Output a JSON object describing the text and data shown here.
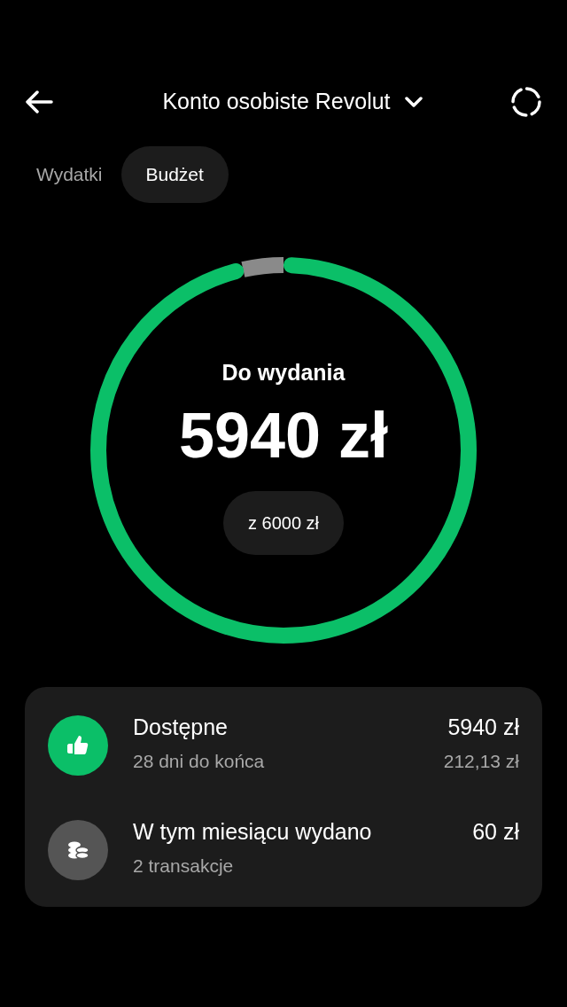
{
  "header": {
    "title": "Konto osobiste Revolut"
  },
  "tabs": [
    {
      "label": "Wydatki",
      "selected": false
    },
    {
      "label": "Budżet",
      "selected": true
    }
  ],
  "budget": {
    "caption": "Do wydania",
    "amount": "5940 zł",
    "total": "z 6000 zł",
    "level": 0.965
  },
  "summary": [
    {
      "kind": "available",
      "title": "Dostępne",
      "subtitle": "28 dni do końca",
      "value": "5940 zł",
      "secondary_value": "212,13 zł"
    },
    {
      "kind": "spent",
      "title": "W tym miesiącu wydano",
      "subtitle": "2 transakcje",
      "value": "60 zł"
    }
  ]
}
